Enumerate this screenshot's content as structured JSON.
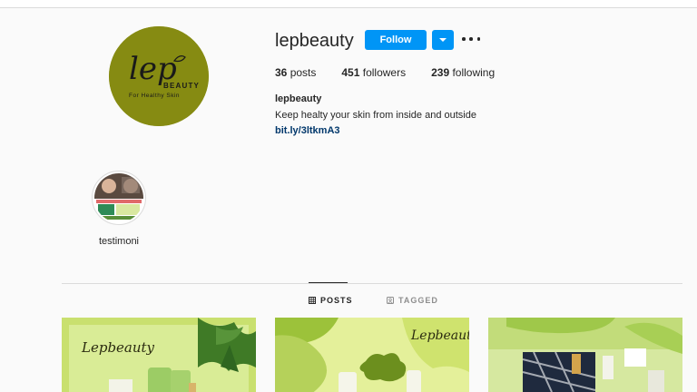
{
  "profile": {
    "username": "lepbeauty",
    "follow_label": "Follow",
    "stats": {
      "posts": "36",
      "posts_label": " posts",
      "followers": "451",
      "followers_label": " followers",
      "following": "239",
      "following_label": " following"
    },
    "full_name": "lepbeauty",
    "bio": "Keep healty your skin from inside and outside",
    "link": "bit.ly/3ltkmA3"
  },
  "logo": {
    "script": "lep",
    "brand": "BEAUTY",
    "tagline": "For Healthy Skin"
  },
  "highlights": [
    {
      "label": "testimoni"
    }
  ],
  "tabs": {
    "posts": "POSTS",
    "tagged": "TAGGED"
  },
  "posts": [
    {
      "caption_overlay": "Lepbeauty"
    },
    {
      "caption_overlay": "Lepbeauty"
    },
    {
      "caption_overlay": ""
    }
  ],
  "colors": {
    "accent": "#0095f6",
    "avatar_bg": "#868b12",
    "post_green": "#cfe38a"
  }
}
